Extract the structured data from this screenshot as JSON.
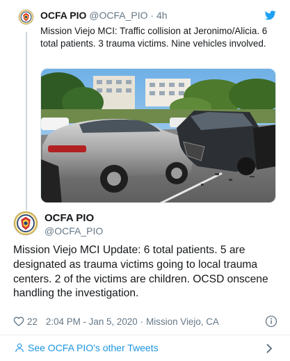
{
  "quoted_tweet": {
    "name": "OCFA PIO",
    "handle": "@OCFA_PIO",
    "separator": "·",
    "age": "4h",
    "text": "Mission Viejo MCI: Traffic collision at Jeronimo/Alicia. 6 total patients. 3 trauma victims. Nine vehicles involved."
  },
  "tweet": {
    "name": "OCFA PIO",
    "handle": "@OCFA_PIO",
    "text": "Mission Viejo MCI Update: 6 total patients. 5 are designated as trauma victims going to local trauma centers. 2 of the victims are children. OCSD onscene handling the investigation.",
    "likes": "22",
    "timestamp": "2:04 PM - Jan 5, 2020",
    "location_separator": "·",
    "location": "Mission Viejo, CA"
  },
  "footer": {
    "label": "See OCFA PIO's other Tweets"
  },
  "icons": {
    "bird": "twitter-bird-icon",
    "heart": "heart-icon",
    "info": "info-icon",
    "person": "person-icon",
    "chevron": "chevron-right-icon"
  },
  "colors": {
    "accent": "#1da1f2",
    "link": "#1b95e0",
    "muted": "#657786",
    "text": "#14171a"
  }
}
